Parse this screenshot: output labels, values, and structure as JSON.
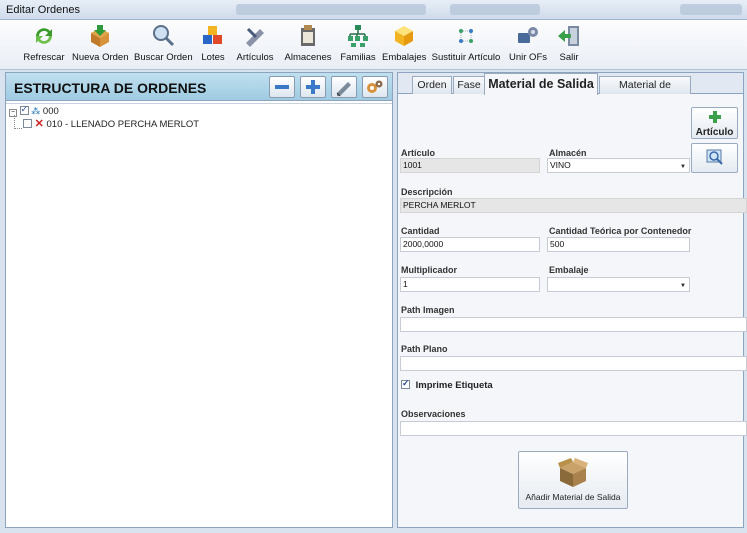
{
  "window": {
    "title": "Editar Ordenes"
  },
  "toolbar": {
    "items": [
      {
        "label": "Refrescar",
        "icon": "refresh-icon"
      },
      {
        "label": "Nueva Orden",
        "icon": "new-order-icon"
      },
      {
        "label": "Buscar Orden",
        "icon": "search-order-icon"
      },
      {
        "label": "Lotes",
        "icon": "batches-icon"
      },
      {
        "label": "Artículos",
        "icon": "articles-icon"
      },
      {
        "label": "Almacenes",
        "icon": "warehouses-icon"
      },
      {
        "label": "Familias",
        "icon": "families-icon"
      },
      {
        "label": "Embalajes",
        "icon": "packaging-icon"
      },
      {
        "label": "Sustituir Artículo",
        "icon": "replace-article-icon"
      },
      {
        "label": "Unir OFs",
        "icon": "merge-orders-icon"
      },
      {
        "label": "Salir",
        "icon": "exit-icon"
      }
    ]
  },
  "left": {
    "header": "ESTRUCTURA DE ORDENES",
    "tree": {
      "root": "000",
      "child": "010 - LLENADO PERCHA MERLOT"
    }
  },
  "tabs": [
    {
      "label": "Orden"
    },
    {
      "label": "Fase"
    },
    {
      "label": "Material de Salida",
      "active": true
    },
    {
      "label": "Material de Entrada"
    }
  ],
  "form": {
    "articulo_btn": "Artículo",
    "articulo": {
      "label": "Artículo",
      "value": "1001"
    },
    "almacen": {
      "label": "Almacén",
      "value": "VINO"
    },
    "descripcion": {
      "label": "Descripción",
      "value": "PERCHA MERLOT"
    },
    "cantidad": {
      "label": "Cantidad",
      "value": "2000,0000"
    },
    "cantidad_teorica": {
      "label": "Cantidad Teórica por Contenedor",
      "value": "500"
    },
    "multiplicador": {
      "label": "Multiplicador",
      "value": "1"
    },
    "embalaje": {
      "label": "Embalaje",
      "value": ""
    },
    "path_imagen": {
      "label": "Path Imagen",
      "value": ""
    },
    "path_plano": {
      "label": "Path Plano",
      "value": ""
    },
    "imprime_etiqueta": {
      "label": "Imprime Etiqueta",
      "checked": true
    },
    "observaciones": {
      "label": "Observaciones",
      "value": ""
    },
    "add_button": "Añadir Material de Salida"
  },
  "colors": {
    "header_bg": "#a8d3e8",
    "window_bg": "#d9e3ef",
    "delete_x": "#cc2222"
  }
}
